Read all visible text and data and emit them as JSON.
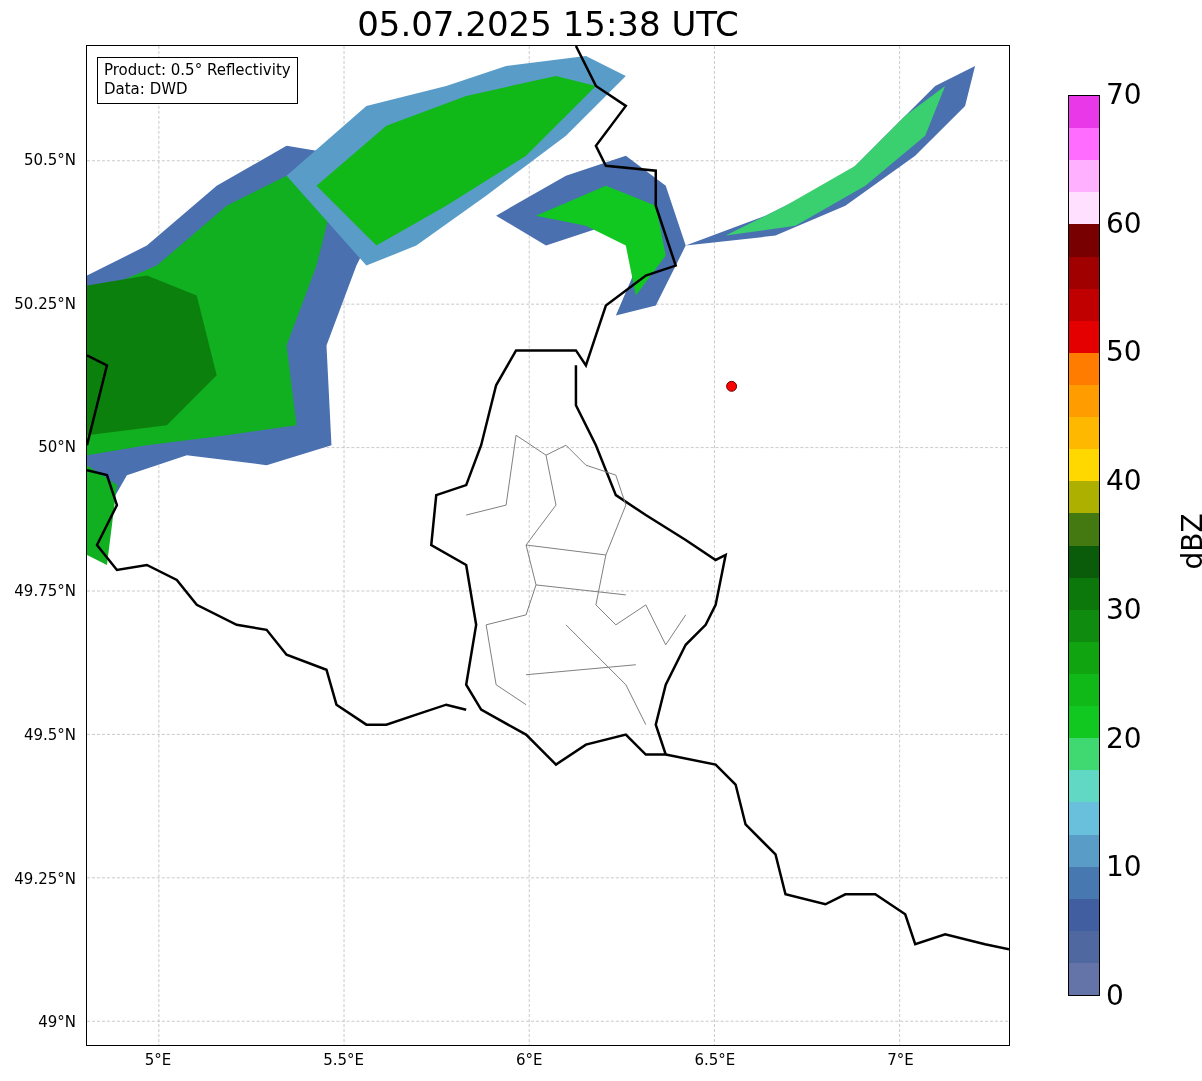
{
  "title": "05.07.2025 15:38 UTC",
  "info_box": {
    "lines": [
      "Product: 0.5° Reflectivity",
      "Data: DWD"
    ]
  },
  "map": {
    "y_ticks": [
      "50.5°N",
      "50.25°N",
      "50°N",
      "49.75°N",
      "49.5°N",
      "49.25°N",
      "49°N"
    ],
    "x_ticks": [
      "5°E",
      "5.5°E",
      "6°E",
      "6.5°E",
      "7°E"
    ]
  },
  "colorbar": {
    "label": "dBZ",
    "ticks": [
      "70",
      "60",
      "50",
      "40",
      "30",
      "20",
      "10",
      "0"
    ],
    "segments": [
      {
        "color": "#e838e8"
      },
      {
        "color": "#ff6cff"
      },
      {
        "color": "#ffb0ff"
      },
      {
        "color": "#ffe0ff"
      },
      {
        "color": "#780000"
      },
      {
        "color": "#a00000"
      },
      {
        "color": "#c00000"
      },
      {
        "color": "#e40000"
      },
      {
        "color": "#ff7c00"
      },
      {
        "color": "#ff9c00"
      },
      {
        "color": "#ffb800"
      },
      {
        "color": "#ffd800"
      },
      {
        "color": "#aeb000"
      },
      {
        "color": "#447810"
      },
      {
        "color": "#0a5c0a"
      },
      {
        "color": "#0c780c"
      },
      {
        "color": "#0f8c10"
      },
      {
        "color": "#10a410"
      },
      {
        "color": "#10b818"
      },
      {
        "color": "#10c820"
      },
      {
        "color": "#40d870"
      },
      {
        "color": "#60d8c4"
      },
      {
        "color": "#68c0dc"
      },
      {
        "color": "#5a9cc8"
      },
      {
        "color": "#4878b0"
      },
      {
        "color": "#405ea0"
      },
      {
        "color": "#5068a0"
      },
      {
        "color": "#6474a8"
      }
    ]
  }
}
